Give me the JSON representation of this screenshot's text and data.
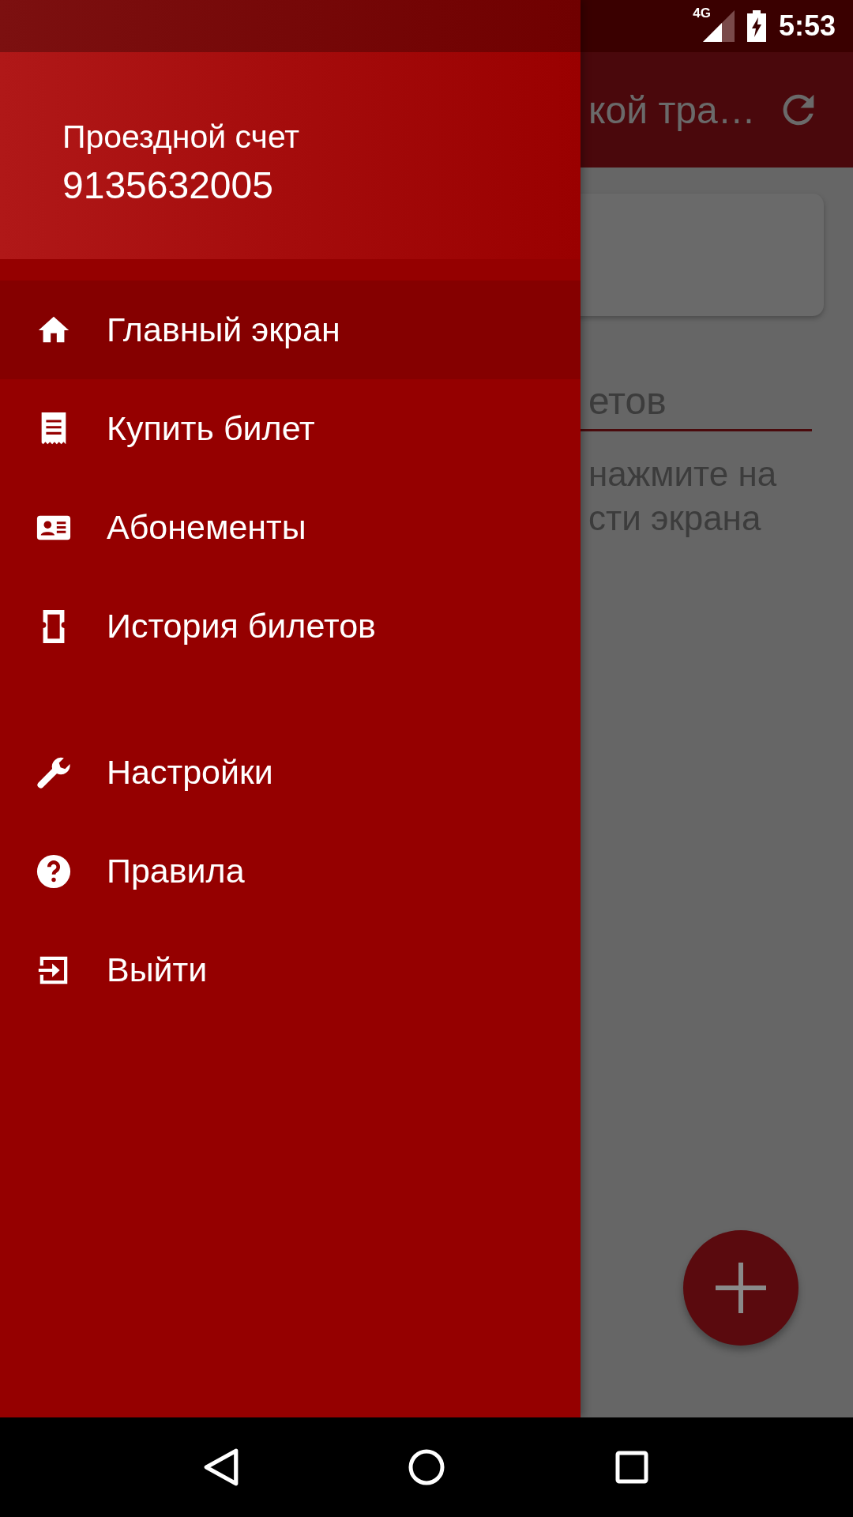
{
  "status_bar": {
    "network": "4G",
    "time": "5:53"
  },
  "background_screen": {
    "toolbar_title": "кой тра…",
    "tab_label": "етов",
    "hint_lines": [
      "нажмите на",
      "сти экрана"
    ]
  },
  "drawer": {
    "account_title": "Проездной счет",
    "account_number": "9135632005",
    "sections": [
      {
        "items": [
          {
            "label": "Главный экран",
            "selected": true
          },
          {
            "label": "Купить билет",
            "selected": false
          },
          {
            "label": "Абонементы",
            "selected": false
          },
          {
            "label": "История билетов",
            "selected": false
          }
        ]
      },
      {
        "items": [
          {
            "label": "Настройки",
            "selected": false
          },
          {
            "label": "Правила",
            "selected": false
          },
          {
            "label": "Выйти",
            "selected": false
          }
        ]
      }
    ]
  }
}
